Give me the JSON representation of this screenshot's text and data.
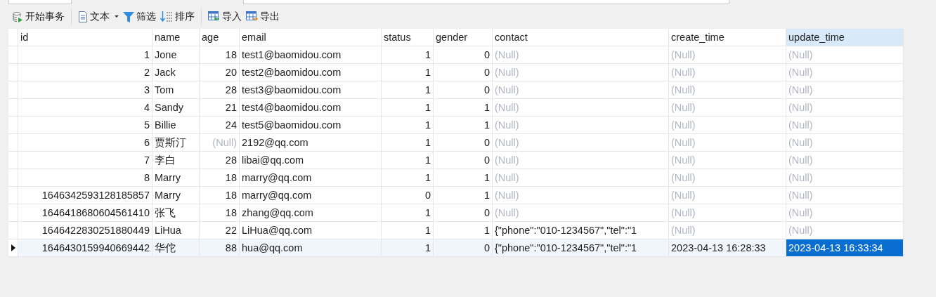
{
  "toolbar": {
    "buttons": [
      {
        "kind": "transaction",
        "label": "开始事务"
      },
      {
        "kind": "text",
        "label": "文本"
      },
      {
        "kind": "filter",
        "label": "筛选"
      },
      {
        "kind": "sort",
        "label": "排序"
      },
      {
        "kind": "import",
        "label": "导入"
      },
      {
        "kind": "export",
        "label": "导出"
      }
    ]
  },
  "table": {
    "columns": [
      {
        "label": "id",
        "selected": false
      },
      {
        "label": "name",
        "selected": false
      },
      {
        "label": "age",
        "selected": false
      },
      {
        "label": "email",
        "selected": false
      },
      {
        "label": "status",
        "selected": false
      },
      {
        "label": "gender",
        "selected": false
      },
      {
        "label": "contact",
        "selected": false
      },
      {
        "label": "create_time",
        "selected": false
      },
      {
        "label": "update_time",
        "selected": true
      }
    ],
    "rows": [
      {
        "current": false,
        "cells": [
          {
            "text": "1",
            "null": false
          },
          {
            "text": "Jone",
            "null": false
          },
          {
            "text": "18",
            "null": false
          },
          {
            "text": "test1@baomidou.com",
            "null": false
          },
          {
            "text": "1",
            "null": false
          },
          {
            "text": "0",
            "null": false
          },
          {
            "text": "(Null)",
            "null": true
          },
          {
            "text": "(Null)",
            "null": true
          },
          {
            "text": "(Null)",
            "null": true
          }
        ]
      },
      {
        "current": false,
        "cells": [
          {
            "text": "2",
            "null": false
          },
          {
            "text": "Jack",
            "null": false
          },
          {
            "text": "20",
            "null": false
          },
          {
            "text": "test2@baomidou.com",
            "null": false
          },
          {
            "text": "1",
            "null": false
          },
          {
            "text": "0",
            "null": false
          },
          {
            "text": "(Null)",
            "null": true
          },
          {
            "text": "(Null)",
            "null": true
          },
          {
            "text": "(Null)",
            "null": true
          }
        ]
      },
      {
        "current": false,
        "cells": [
          {
            "text": "3",
            "null": false
          },
          {
            "text": "Tom",
            "null": false
          },
          {
            "text": "28",
            "null": false
          },
          {
            "text": "test3@baomidou.com",
            "null": false
          },
          {
            "text": "1",
            "null": false
          },
          {
            "text": "0",
            "null": false
          },
          {
            "text": "(Null)",
            "null": true
          },
          {
            "text": "(Null)",
            "null": true
          },
          {
            "text": "(Null)",
            "null": true
          }
        ]
      },
      {
        "current": false,
        "cells": [
          {
            "text": "4",
            "null": false
          },
          {
            "text": "Sandy",
            "null": false
          },
          {
            "text": "21",
            "null": false
          },
          {
            "text": "test4@baomidou.com",
            "null": false
          },
          {
            "text": "1",
            "null": false
          },
          {
            "text": "1",
            "null": false
          },
          {
            "text": "(Null)",
            "null": true
          },
          {
            "text": "(Null)",
            "null": true
          },
          {
            "text": "(Null)",
            "null": true
          }
        ]
      },
      {
        "current": false,
        "cells": [
          {
            "text": "5",
            "null": false
          },
          {
            "text": "Billie",
            "null": false
          },
          {
            "text": "24",
            "null": false
          },
          {
            "text": "test5@baomidou.com",
            "null": false
          },
          {
            "text": "1",
            "null": false
          },
          {
            "text": "1",
            "null": false
          },
          {
            "text": "(Null)",
            "null": true
          },
          {
            "text": "(Null)",
            "null": true
          },
          {
            "text": "(Null)",
            "null": true
          }
        ]
      },
      {
        "current": false,
        "cells": [
          {
            "text": "6",
            "null": false
          },
          {
            "text": "贾斯汀",
            "null": false
          },
          {
            "text": "(Null)",
            "null": true
          },
          {
            "text": "2192@qq.com",
            "null": false
          },
          {
            "text": "1",
            "null": false
          },
          {
            "text": "0",
            "null": false
          },
          {
            "text": "(Null)",
            "null": true
          },
          {
            "text": "(Null)",
            "null": true
          },
          {
            "text": "(Null)",
            "null": true
          }
        ]
      },
      {
        "current": false,
        "cells": [
          {
            "text": "7",
            "null": false
          },
          {
            "text": "李白",
            "null": false
          },
          {
            "text": "28",
            "null": false
          },
          {
            "text": "libai@qq.com",
            "null": false
          },
          {
            "text": "1",
            "null": false
          },
          {
            "text": "0",
            "null": false
          },
          {
            "text": "(Null)",
            "null": true
          },
          {
            "text": "(Null)",
            "null": true
          },
          {
            "text": "(Null)",
            "null": true
          }
        ]
      },
      {
        "current": false,
        "cells": [
          {
            "text": "8",
            "null": false
          },
          {
            "text": "Marry",
            "null": false
          },
          {
            "text": "18",
            "null": false
          },
          {
            "text": "marry@qq.com",
            "null": false
          },
          {
            "text": "1",
            "null": false
          },
          {
            "text": "1",
            "null": false
          },
          {
            "text": "(Null)",
            "null": true
          },
          {
            "text": "(Null)",
            "null": true
          },
          {
            "text": "(Null)",
            "null": true
          }
        ]
      },
      {
        "current": false,
        "cells": [
          {
            "text": "1646342593128185857",
            "null": false
          },
          {
            "text": "Marry",
            "null": false
          },
          {
            "text": "18",
            "null": false
          },
          {
            "text": "marry@qq.com",
            "null": false
          },
          {
            "text": "0",
            "null": false
          },
          {
            "text": "1",
            "null": false
          },
          {
            "text": "(Null)",
            "null": true
          },
          {
            "text": "(Null)",
            "null": true
          },
          {
            "text": "(Null)",
            "null": true
          }
        ]
      },
      {
        "current": false,
        "cells": [
          {
            "text": "1646418680604561410",
            "null": false
          },
          {
            "text": "张飞",
            "null": false
          },
          {
            "text": "18",
            "null": false
          },
          {
            "text": "zhang@qq.com",
            "null": false
          },
          {
            "text": "1",
            "null": false
          },
          {
            "text": "0",
            "null": false
          },
          {
            "text": "(Null)",
            "null": true
          },
          {
            "text": "(Null)",
            "null": true
          },
          {
            "text": "(Null)",
            "null": true
          }
        ]
      },
      {
        "current": false,
        "cells": [
          {
            "text": "1646422830251880449",
            "null": false
          },
          {
            "text": "LiHua",
            "null": false
          },
          {
            "text": "22",
            "null": false
          },
          {
            "text": "LiHua@qq.com",
            "null": false
          },
          {
            "text": "1",
            "null": false
          },
          {
            "text": "1",
            "null": false
          },
          {
            "text": "{\"phone\":\"010-1234567\",\"tel\":\"1",
            "null": false
          },
          {
            "text": "(Null)",
            "null": true
          },
          {
            "text": "(Null)",
            "null": true
          }
        ]
      },
      {
        "current": true,
        "cells": [
          {
            "text": "1646430159940669442",
            "null": false
          },
          {
            "text": "华佗",
            "null": false
          },
          {
            "text": "88",
            "null": false
          },
          {
            "text": "hua@qq.com",
            "null": false
          },
          {
            "text": "1",
            "null": false
          },
          {
            "text": "0",
            "null": false
          },
          {
            "text": "{\"phone\":\"010-1234567\",\"tel\":\"1",
            "null": false
          },
          {
            "text": "2023-04-13 16:28:33",
            "null": false
          },
          {
            "text": "2023-04-13 16:33:34",
            "null": false
          }
        ]
      }
    ]
  }
}
